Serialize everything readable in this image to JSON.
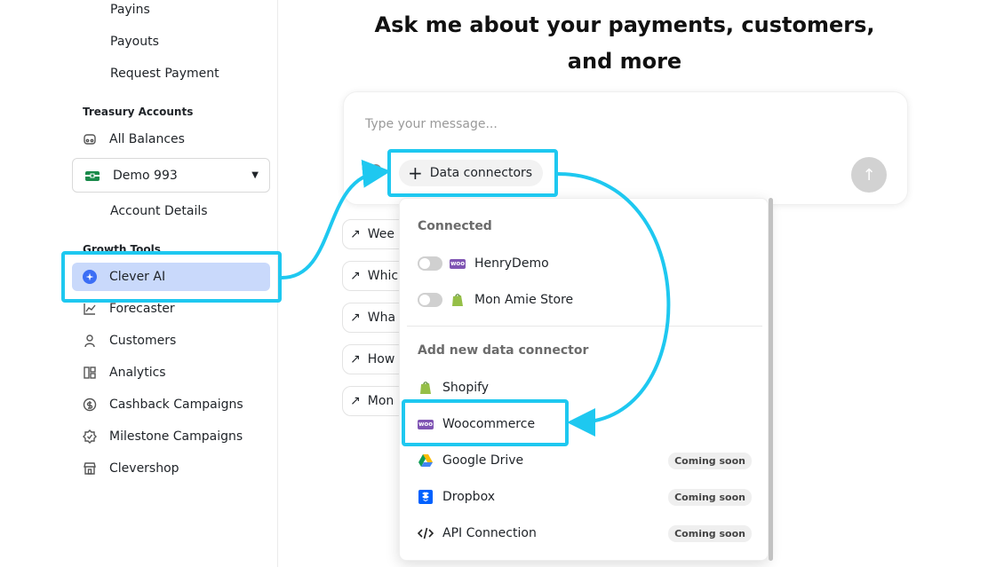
{
  "sidebar": {
    "payments_sub": [
      "Payins",
      "Payouts",
      "Request Payment"
    ],
    "treasury_label": "Treasury Accounts",
    "all_balances": "All Balances",
    "account_select": "Demo 993",
    "account_details": "Account Details",
    "growth_label": "Growth Tools",
    "growth_items": [
      {
        "label": "Clever AI",
        "icon": "sparkle-icon",
        "active": true
      },
      {
        "label": "Forecaster",
        "icon": "chart-line-icon"
      },
      {
        "label": "Customers",
        "icon": "user-icon"
      },
      {
        "label": "Analytics",
        "icon": "layout-icon"
      },
      {
        "label": "Cashback Campaigns",
        "icon": "coin-icon"
      },
      {
        "label": "Milestone Campaigns",
        "icon": "badge-icon"
      },
      {
        "label": "Clevershop",
        "icon": "store-icon"
      }
    ]
  },
  "main": {
    "headline": "Ask me about your payments, customers, and more",
    "composer_placeholder": "Type your message...",
    "data_connectors_label": "Data connectors",
    "suggestions": [
      "Wee",
      "Whic",
      "Wha",
      "How",
      "Mon"
    ]
  },
  "dropdown": {
    "connected_label": "Connected",
    "connected": [
      {
        "label": "HenryDemo",
        "logo": "woocommerce-logo"
      },
      {
        "label": "Mon Amie Store",
        "logo": "shopify-logo"
      }
    ],
    "add_label": "Add new data connector",
    "add": [
      {
        "label": "Shopify",
        "logo": "shopify-logo",
        "badge": ""
      },
      {
        "label": "Woocommerce",
        "logo": "woocommerce-logo",
        "badge": ""
      },
      {
        "label": "Google Drive",
        "logo": "google-drive-logo",
        "badge": "Coming soon"
      },
      {
        "label": "Dropbox",
        "logo": "dropbox-logo",
        "badge": "Coming soon"
      },
      {
        "label": "API Connection",
        "logo": "code-icon",
        "badge": "Coming soon"
      }
    ]
  },
  "colors": {
    "highlight": "#1ec8f0",
    "active_bg": "#c9d9fb",
    "woo": "#7f54b3",
    "shopify": "#95bf47"
  }
}
